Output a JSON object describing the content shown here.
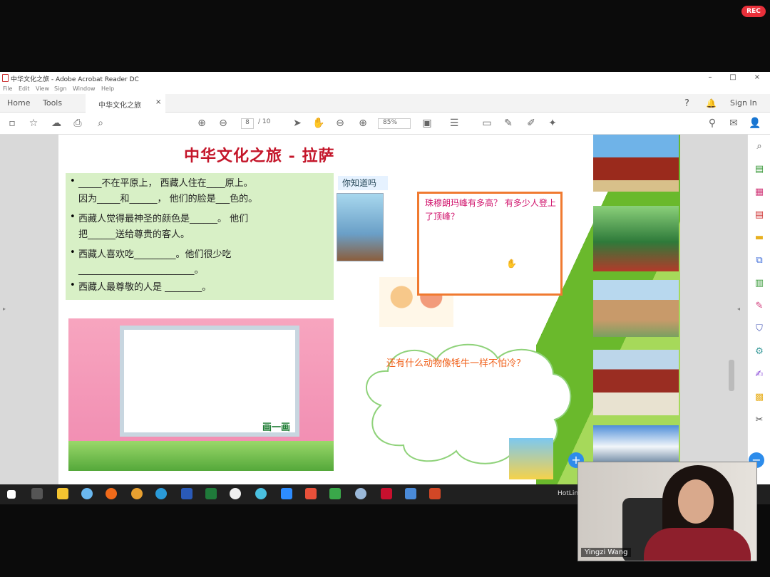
{
  "recording": {
    "label": "REC"
  },
  "window": {
    "title": "中华文化之旅 - Adobe Acrobat Reader DC",
    "menu": [
      "File",
      "Edit",
      "View",
      "Sign",
      "Window",
      "Help"
    ],
    "tabs": {
      "home": "Home",
      "tools": "Tools",
      "document": "中华文化之旅",
      "close": "×"
    },
    "sign_in": "Sign In",
    "controls": {
      "minimize": "–",
      "maximize": "□",
      "close": "×"
    }
  },
  "toolbar": {
    "page_current": "8",
    "page_total": "/ 10",
    "zoom": "85%"
  },
  "page": {
    "title": "中华文化之旅 - 拉萨",
    "questions": [
      {
        "line1": "_____不在平原上， 西藏人住在____原上。",
        "line2": "因为_____和______，  他们的脸是___色的。"
      },
      {
        "line1": "西藏人觉得最神圣的颜色是______。 他们",
        "line2": "把______送给尊贵的客人。"
      },
      {
        "line1": "西藏人喜欢吃_________。他们很少吃",
        "line2": "_________________________。"
      },
      {
        "line1": "西藏人最尊敬的人是 ________。",
        "line2": ""
      }
    ],
    "did_you_know": "你知道吗",
    "everest_question": "珠穆朗玛峰有多高？ 有多少人登上了顶峰？",
    "cloud_question": "还有什么动物像牦牛一样不怕冷？",
    "draw_label": "画一画"
  },
  "taskbar": {
    "hotline": "HotLin"
  },
  "webcam": {
    "name": "Yingzi Wang"
  },
  "icons": [
    "star-icon",
    "upload-icon",
    "print-icon",
    "zoom-icon",
    "up-icon",
    "down-icon",
    "hand-icon",
    "minus-icon",
    "plus-icon",
    "comment-icon",
    "pen-icon",
    "help-icon",
    "bell-icon"
  ]
}
